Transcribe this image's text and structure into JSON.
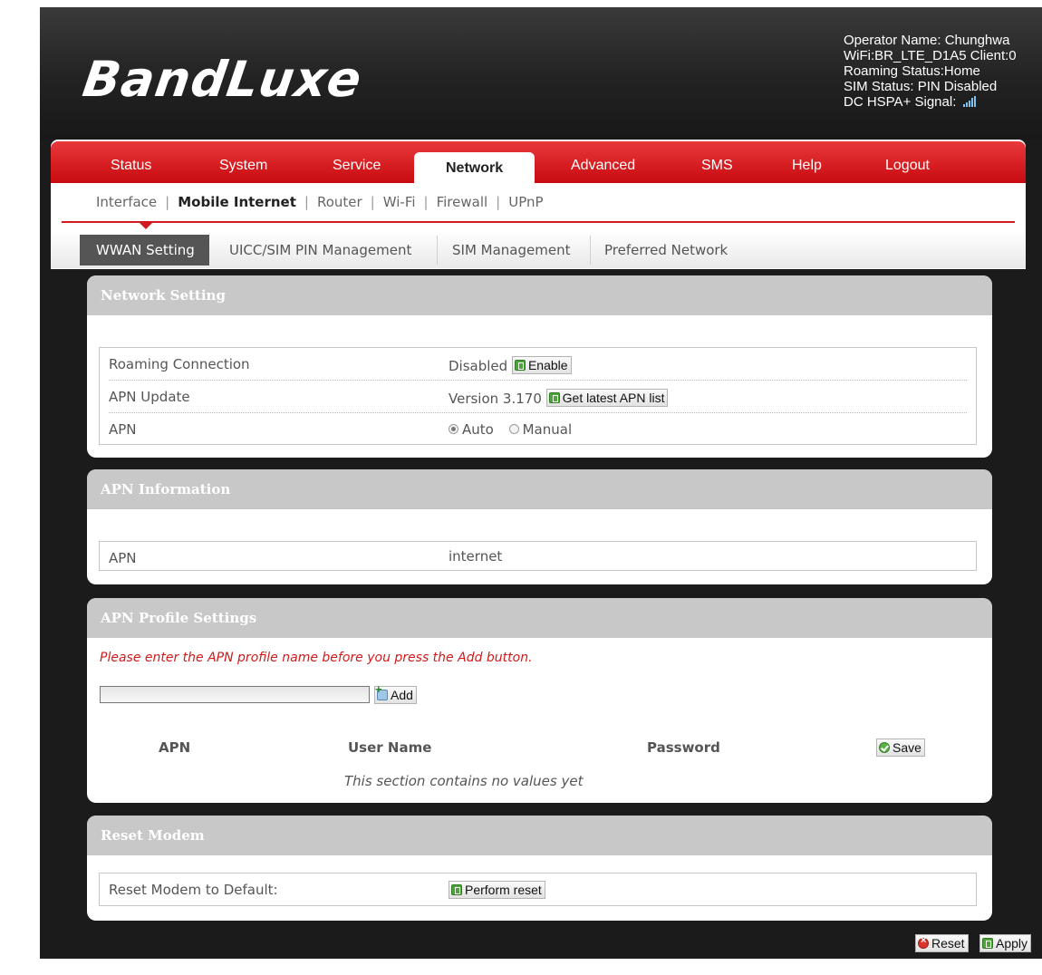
{
  "brand": {
    "logo_text": "BandLuxe"
  },
  "status": {
    "operator": "Operator Name: Chunghwa",
    "wifi": "WiFi:BR_LTE_D1A5 Client:0",
    "roaming": "Roaming Status:Home",
    "sim": "SIM Status: PIN Disabled",
    "signal": "DC HSPA+ Signal:"
  },
  "tabs": [
    "Status",
    "System",
    "Service",
    "Network",
    "Advanced",
    "SMS",
    "Help",
    "Logout"
  ],
  "active_tab": "Network",
  "subnav": [
    "Interface",
    "Mobile Internet",
    "Router",
    "Wi-Fi",
    "Firewall",
    "UPnP"
  ],
  "active_subnav": "Mobile Internet",
  "subtabs": [
    "WWAN Setting",
    "UICC/SIM PIN Management",
    "SIM Management",
    "Preferred Network"
  ],
  "active_subtab": "WWAN Setting",
  "network_setting": {
    "title": "Network Setting",
    "roaming_label": "Roaming Connection",
    "roaming_value": "Disabled",
    "enable_button": "Enable",
    "apn_update_label": "APN Update",
    "apn_version": "Version 3.170",
    "get_apn_button": "Get latest APN list",
    "apn_label": "APN",
    "apn_mode_auto": "Auto",
    "apn_mode_manual": "Manual",
    "apn_mode_selected": "Auto"
  },
  "apn_information": {
    "title": "APN Information",
    "apn_label": "APN",
    "apn_value": "internet"
  },
  "apn_profile": {
    "title": "APN Profile Settings",
    "hint": "Please enter the APN profile name before you press the Add button.",
    "input_value": "",
    "add_button": "Add",
    "columns": [
      "APN",
      "User Name",
      "Password"
    ],
    "save_button": "Save",
    "empty_message": "This section contains no values yet"
  },
  "reset_modem": {
    "title": "Reset Modem",
    "label": "Reset Modem to Default:",
    "button": "Perform reset"
  },
  "footer": {
    "reset_button": "Reset",
    "apply_button": "Apply"
  }
}
